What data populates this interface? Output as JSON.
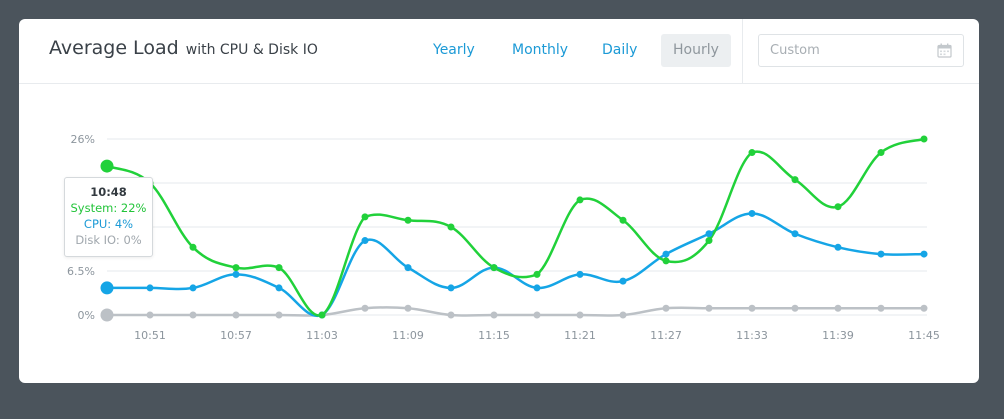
{
  "header": {
    "title": "Average Load",
    "subtitle": "with CPU & Disk IO",
    "ranges": [
      {
        "label": "Yearly",
        "active": false
      },
      {
        "label": "Monthly",
        "active": false
      },
      {
        "label": "Daily",
        "active": false
      },
      {
        "label": "Hourly",
        "active": true
      }
    ],
    "custom_placeholder": "Custom",
    "custom_icon": "calendar-icon"
  },
  "tooltip": {
    "time": "10:48",
    "system": "System: 22%",
    "cpu": "CPU: 4%",
    "disk": "Disk IO: 0%"
  },
  "colors": {
    "system": "#21d13a",
    "cpu": "#15a5e6",
    "disk": "#bcc1c6",
    "grid": "#e6e9ec",
    "background": "#4b545c"
  },
  "chart_data": {
    "type": "line",
    "title": "",
    "xlabel": "",
    "ylabel": "",
    "x": [
      "10:48",
      "10:51",
      "10:54",
      "10:57",
      "11:00",
      "11:03",
      "11:06",
      "11:09",
      "11:12",
      "11:15",
      "11:18",
      "11:21",
      "11:24",
      "11:27",
      "11:30",
      "11:33",
      "11:36",
      "11:39",
      "11:42",
      "11:45"
    ],
    "x_tick_labels": [
      "10:51",
      "10:57",
      "11:03",
      "11:09",
      "11:15",
      "11:21",
      "11:27",
      "11:33",
      "11:39",
      "11:45"
    ],
    "y_tick_labels": [
      "0%",
      "6.5%",
      "26%"
    ],
    "ylim": [
      0,
      26
    ],
    "grid": true,
    "series": [
      {
        "name": "System",
        "values": [
          22,
          19.5,
          10,
          7,
          7,
          0,
          14.5,
          14,
          13,
          7,
          6,
          17,
          14,
          8,
          11,
          24,
          20,
          16,
          24,
          26
        ]
      },
      {
        "name": "CPU",
        "values": [
          4,
          4,
          4,
          6,
          4,
          0,
          11,
          7,
          4,
          7,
          4,
          6,
          5,
          9,
          12,
          15,
          12,
          10,
          9,
          9
        ]
      },
      {
        "name": "Disk IO",
        "values": [
          0,
          0,
          0,
          0,
          0,
          0,
          1,
          1,
          0,
          0,
          0,
          0,
          0,
          1,
          1,
          1,
          1,
          1,
          1,
          1
        ]
      }
    ]
  }
}
